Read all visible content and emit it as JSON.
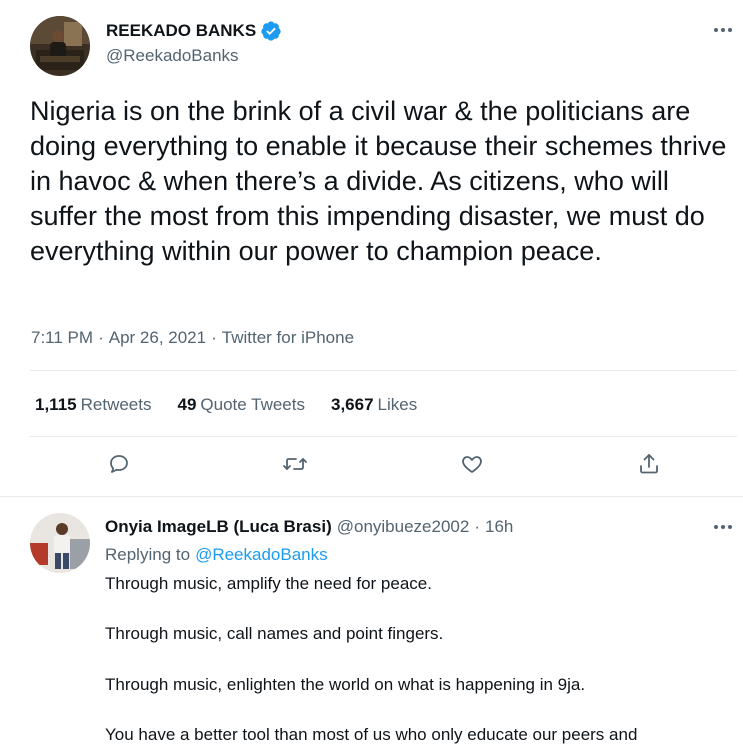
{
  "main_tweet": {
    "author_name": "REEKADO BANKS",
    "author_handle": "@ReekadoBanks",
    "text": "Nigeria is on the brink of a civil war & the politicians are doing everything to enable it because their schemes thrive in havoc & when there’s a divide. As citizens, who will suffer the most from this impending disaster, we must do everything within our power to champion peace.",
    "time": "7:11 PM",
    "date": "Apr 26, 2021",
    "source": "Twitter for iPhone",
    "separator": "·",
    "stats": {
      "retweets_count": "1,115",
      "retweets_label": "Retweets",
      "quotes_count": "49",
      "quotes_label": "Quote Tweets",
      "likes_count": "3,667",
      "likes_label": "Likes"
    },
    "icons": {
      "verified": "verified-badge-icon",
      "more": "more-icon",
      "reply": "reply-icon",
      "retweet": "retweet-icon",
      "like": "like-icon",
      "share": "share-icon"
    }
  },
  "reply": {
    "author_name": "Onyia ImageLB (Luca Brasi)",
    "author_handle": "@onyibueze2002",
    "separator": "·",
    "time": "16h",
    "replying_prefix": "Replying to",
    "replying_to": "@ReekadoBanks",
    "lines": [
      "Through music, amplify the need for peace.",
      "Through music, call names and point fingers.",
      "Through music, enlighten the world on what is happening in 9ja.",
      "You have a better tool than most of us who only educate our peers and"
    ]
  },
  "colors": {
    "accent": "#1d9bf0",
    "text": "#0f1419",
    "secondary": "#536471",
    "divider": "#e7e9ea"
  }
}
